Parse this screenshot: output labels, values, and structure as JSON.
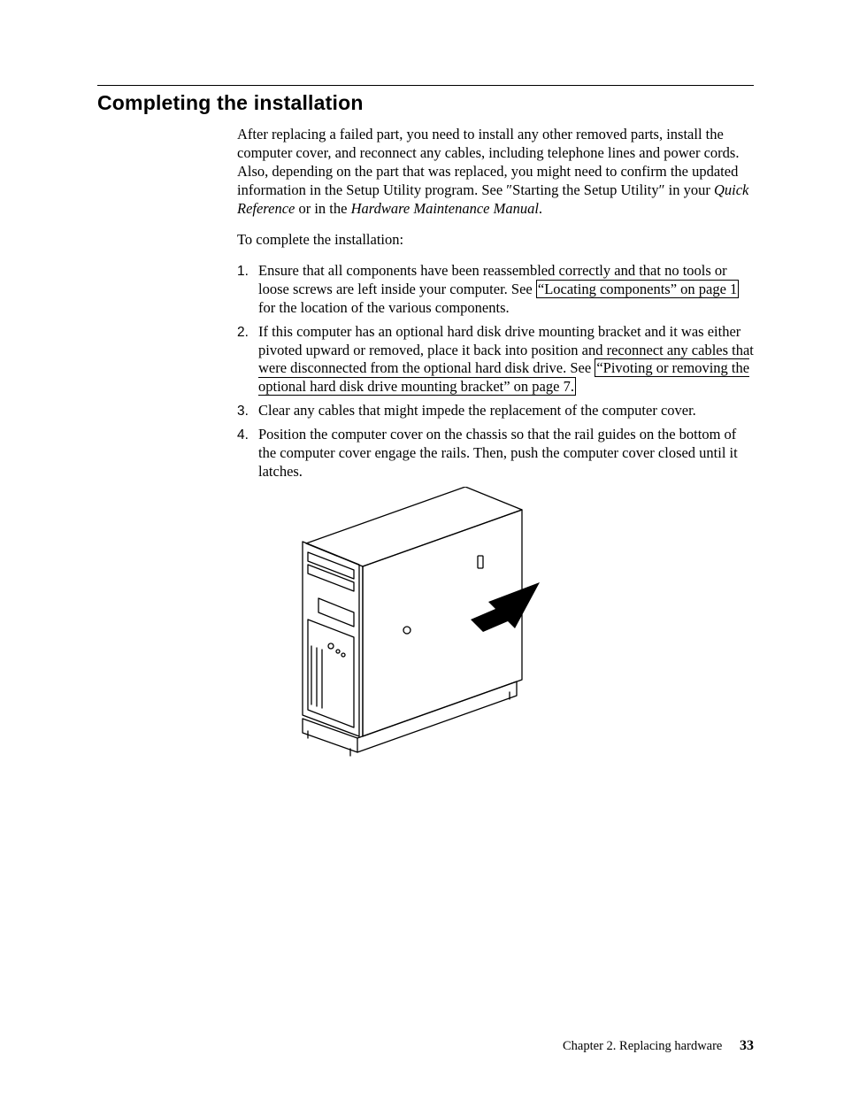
{
  "heading": "Completing the installation",
  "intro_html": "After replacing a failed part, you need to install any other removed parts, install the computer cover, and reconnect any cables, including telephone lines and power cords. Also, depending on the part that was replaced, you might need to confirm the updated information in the Setup Utility program. See ″Starting the Setup Utility″ in your <span class=\"italic\">Quick Reference</span> or in the <span class=\"italic\">Hardware Maintenance Manual</span>.",
  "lead_in": "To complete the installation:",
  "steps": [
    {
      "num": "1.",
      "html": "Ensure that all components have been reassembled correctly and that no tools or loose screws are left inside your computer. See <span class=\"xref\">“Locating components” on page 1</span> for the location of the various components."
    },
    {
      "num": "2.",
      "html": "If this computer has an optional hard disk drive mounting bracket and it was either pivoted upward or removed, place it back into position and reconnect any cables that were disconnected from the optional hard disk drive. See <span class=\"xref\">“Pivoting or removing the optional hard disk drive mounting bracket” on page 7.</span>"
    },
    {
      "num": "3.",
      "html": "Clear any cables that might impede the replacement of the computer cover."
    },
    {
      "num": "4.",
      "html": "Position the computer cover on the chassis so that the rail guides on the bottom of the computer cover engage the rails. Then, push the computer cover closed until it latches."
    }
  ],
  "figure_alt": "Line drawing of a desktop tower computer with an arrow indicating sliding the side cover closed toward the front.",
  "footer": {
    "chapter": "Chapter 2. Replacing hardware",
    "page_number": "33"
  }
}
